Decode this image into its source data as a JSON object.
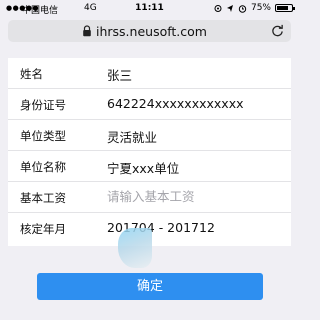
{
  "status": {
    "carrier": "中国电信",
    "network": "4G",
    "time": "11:11",
    "battery": "75%",
    "battery_level": 0.75
  },
  "browser": {
    "url": "ihrss.neusoft.com"
  },
  "form": {
    "rows": [
      {
        "label": "姓名",
        "value": "张三"
      },
      {
        "label": "身份证号",
        "value": "642224xxxxxxxxxxxx"
      },
      {
        "label": "单位类型",
        "value": "灵活就业"
      },
      {
        "label": "单位名称",
        "value": "宁夏xxx单位"
      },
      {
        "label": "基本工资",
        "placeholder": "请输入基本工资"
      },
      {
        "label": "核定年月",
        "value": "201704 - 201712"
      }
    ]
  },
  "confirm_label": "确定",
  "colors": {
    "accent": "#2e8ff0",
    "background": "#f0eff4"
  }
}
